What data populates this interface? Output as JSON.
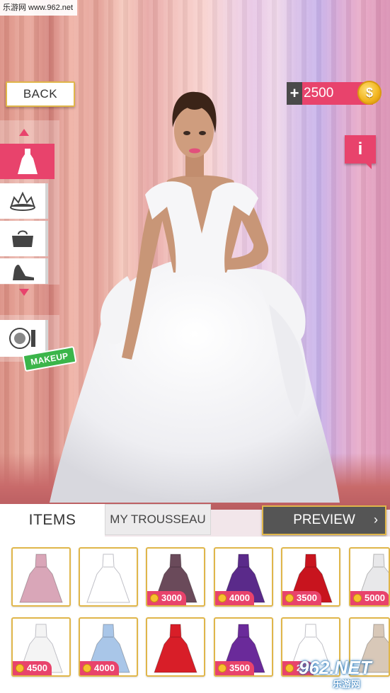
{
  "watermark": {
    "site": "乐游网 www.962.net"
  },
  "header": {
    "back_label": "BACK",
    "coins_plus": "+",
    "coins_amount": "2500",
    "coin_symbol": "$",
    "info_label": "i"
  },
  "categories": [
    {
      "name": "dress",
      "icon": "dress-icon",
      "active": true
    },
    {
      "name": "tiara",
      "icon": "tiara-icon",
      "active": false
    },
    {
      "name": "bag",
      "icon": "handbag-icon",
      "active": false
    },
    {
      "name": "shoes",
      "icon": "heel-shoe-icon",
      "active": false
    }
  ],
  "makeup": {
    "label": "MAKEUP",
    "icon": "compact-makeup-icon"
  },
  "tabs": {
    "items": "ITEMS",
    "trousseau": "MY TROUSSEAU"
  },
  "preview": {
    "label": "PREVIEW",
    "chevron": "›"
  },
  "items": [
    {
      "color": "#d9a6b8",
      "price": ""
    },
    {
      "color": "#ffffff",
      "price": ""
    },
    {
      "color": "#6a4a5a",
      "price": "3000"
    },
    {
      "color": "#5a2a8a",
      "price": "4000"
    },
    {
      "color": "#c8141e",
      "price": "3500"
    },
    {
      "color": "#e8e8ea",
      "price": "5000"
    },
    {
      "color": "#f4f4f4",
      "price": "4500"
    },
    {
      "color": "#a9c6e8",
      "price": "4000"
    },
    {
      "color": "#d81e28",
      "price": ""
    },
    {
      "color": "#6a2a9a",
      "price": "3500"
    },
    {
      "color": "#ffffff",
      "price": "2..."
    },
    {
      "color": "#d8c8b8",
      "price": ""
    }
  ],
  "brand_watermark": {
    "text": "962.NET",
    "sub": "乐游网"
  },
  "colors": {
    "accent": "#e8436c",
    "gold": "#e0b64a",
    "makeup_green": "#3bb54a"
  }
}
